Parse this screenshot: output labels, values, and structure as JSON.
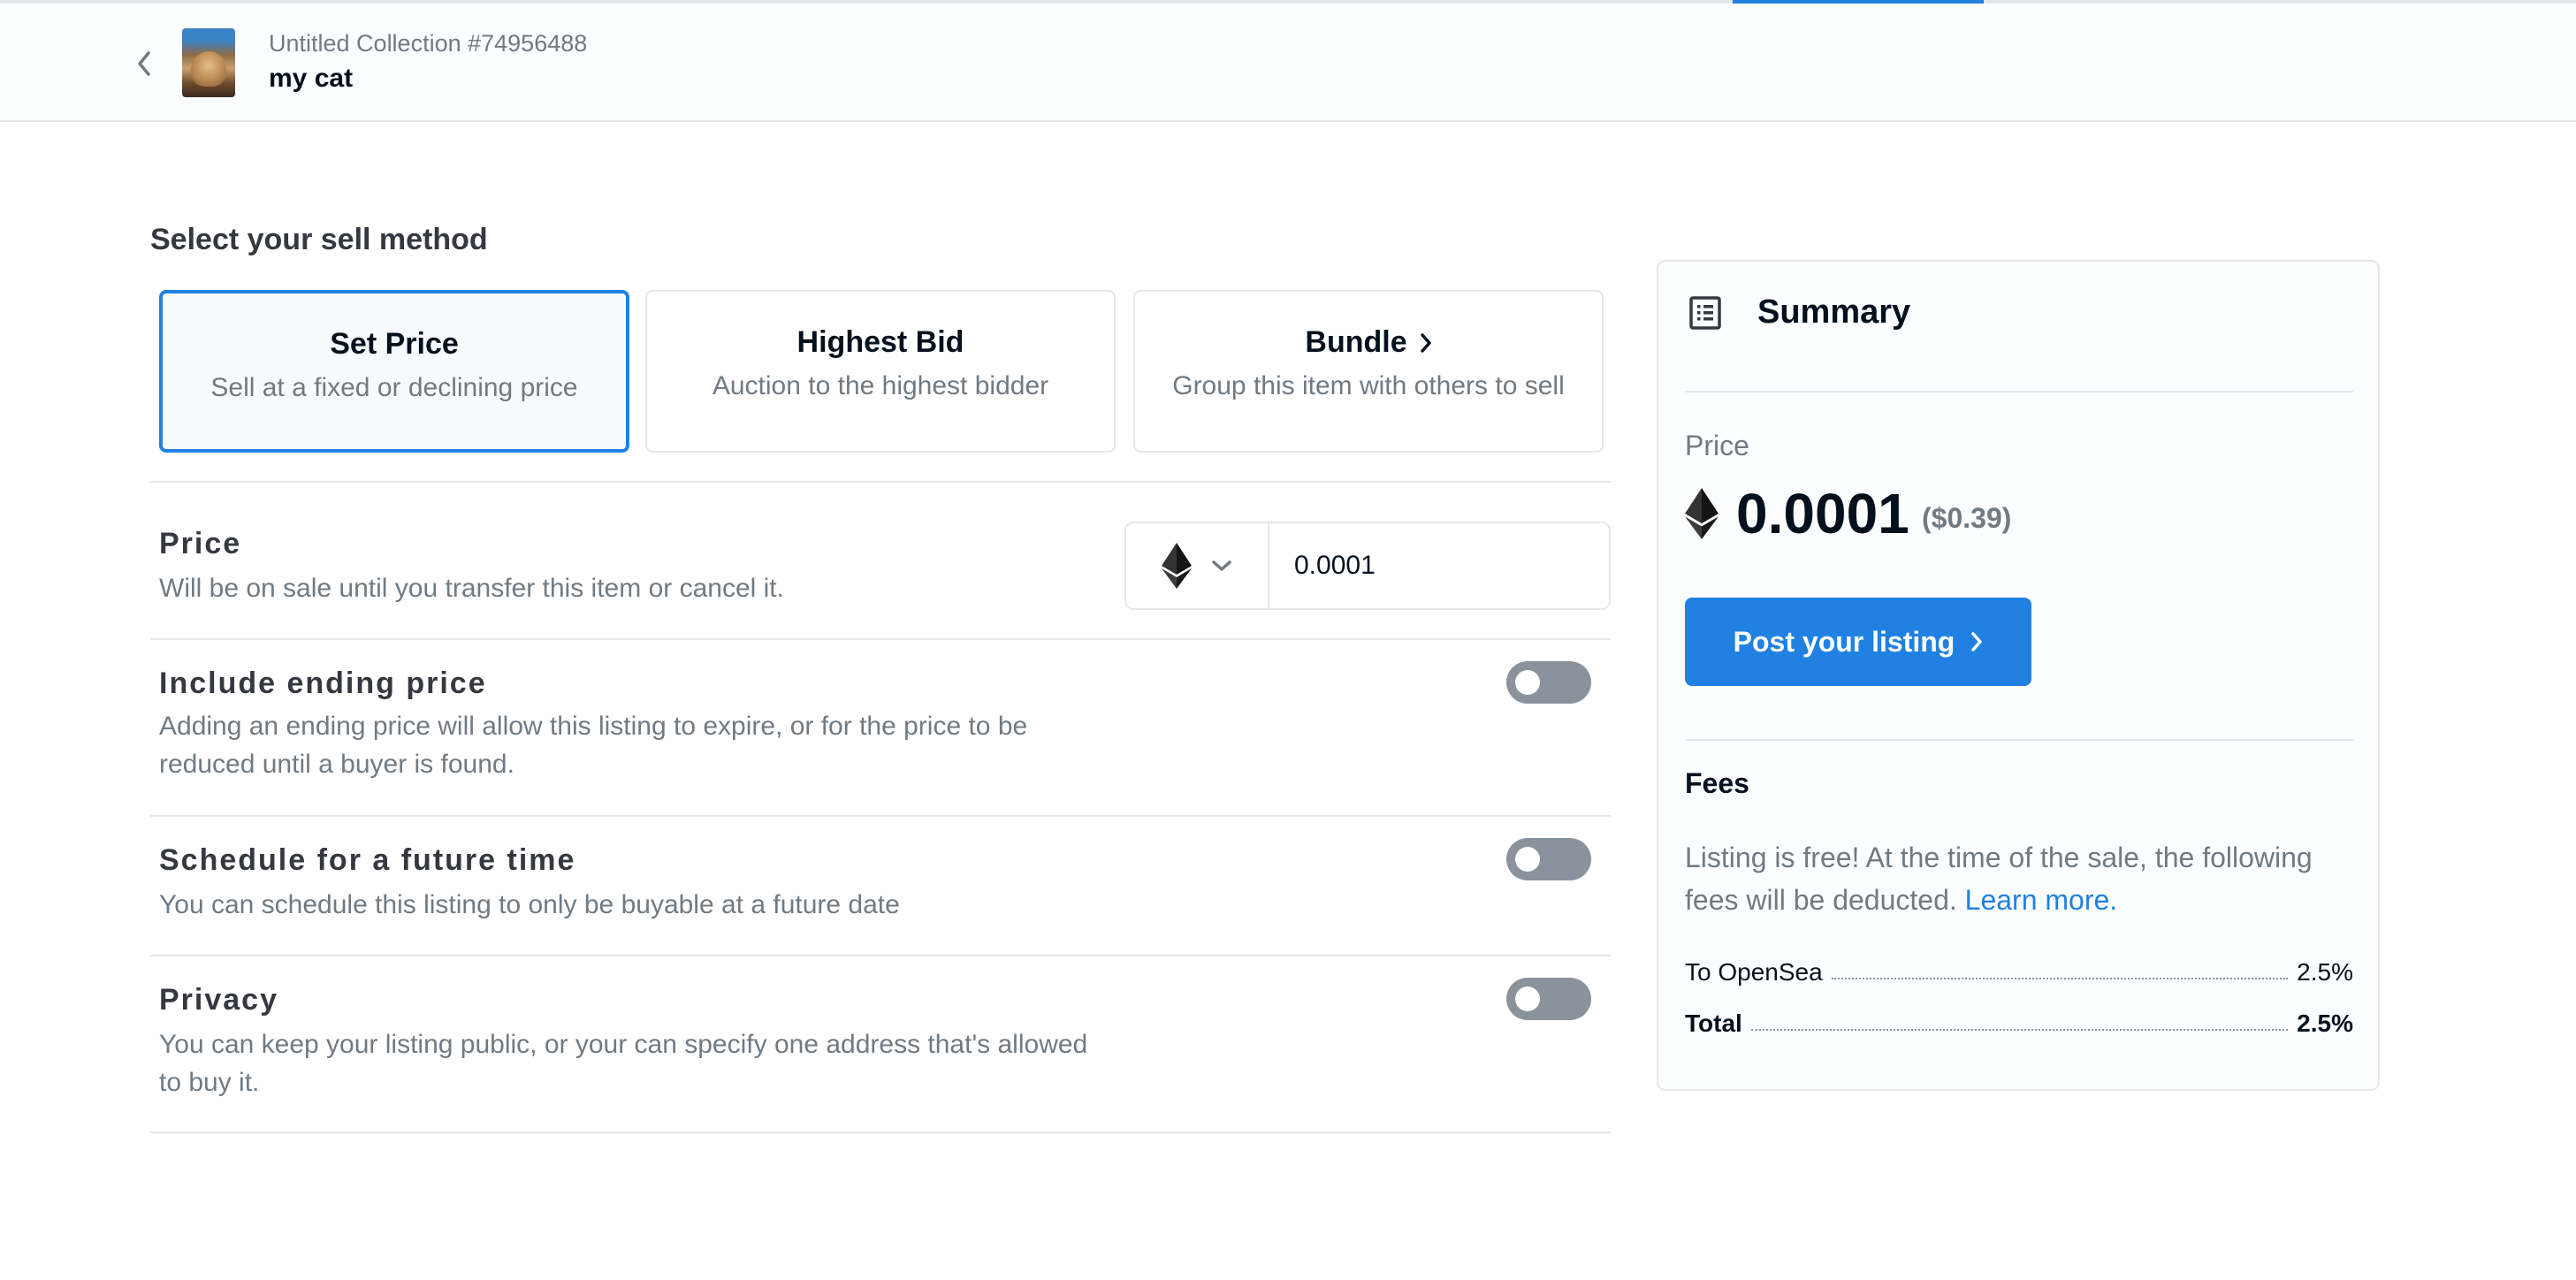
{
  "header": {
    "collection": "Untitled Collection #74956488",
    "item_name": "my cat"
  },
  "sell_method": {
    "title": "Select your sell method",
    "options": [
      {
        "title": "Set Price",
        "subtitle": "Sell at a fixed or declining price",
        "active": true
      },
      {
        "title": "Highest Bid",
        "subtitle": "Auction to the highest bidder",
        "active": false
      },
      {
        "title": "Bundle",
        "subtitle": "Group this item with others to sell",
        "active": false
      }
    ]
  },
  "price": {
    "title": "Price",
    "description": "Will be on sale until you transfer this item or cancel it.",
    "currency_icon": "ethereum-icon",
    "value": "0.0001"
  },
  "options": [
    {
      "title": "Include ending price",
      "description": "Adding an ending price will allow this listing to expire, or for the price to be reduced until a buyer is found.",
      "enabled": false
    },
    {
      "title": "Schedule for a future time",
      "description": "You can schedule this listing to only be buyable at a future date",
      "enabled": false
    },
    {
      "title": "Privacy",
      "description": "You can keep your listing public, or your can specify one address that's allowed to buy it.",
      "enabled": false
    }
  ],
  "summary": {
    "title": "Summary",
    "price_label": "Price",
    "price": "0.0001",
    "price_usd": "($0.39)",
    "post_button": "Post your listing",
    "fees_title": "Fees",
    "fees_text": "Listing is free! At the time of the sale, the following fees will be deducted.",
    "learn_more": "Learn more.",
    "fees": [
      {
        "label": "To OpenSea",
        "value": "2.5%"
      },
      {
        "label": "Total",
        "value": "2.5%"
      }
    ]
  },
  "colors": {
    "accent": "#2081e2",
    "toggle_off": "#8a939b"
  }
}
